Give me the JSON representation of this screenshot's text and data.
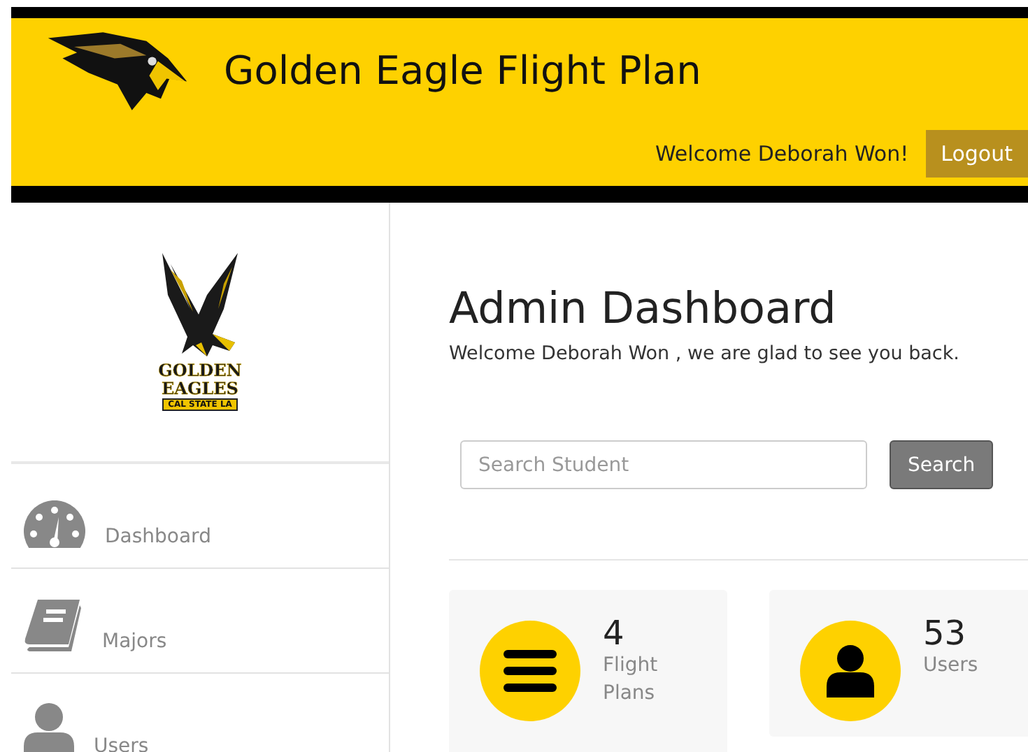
{
  "header": {
    "title": "Golden Eagle Flight Plan",
    "welcome": "Welcome Deborah Won!",
    "logout": "Logout"
  },
  "sidebar": {
    "logo": {
      "line_1": "GOLDEN",
      "line_2": "EAGLES",
      "banner": "CAL STATE LA"
    },
    "items": [
      {
        "label": "Dashboard",
        "kind": "gauge"
      },
      {
        "label": "Majors",
        "kind": "book"
      },
      {
        "label": "Users",
        "kind": "user"
      }
    ]
  },
  "main": {
    "title": "Admin Dashboard",
    "subtitle": "Welcome Deborah Won , we are glad to see you back.",
    "search": {
      "placeholder": "Search Student",
      "button": "Search"
    },
    "stats": [
      {
        "value": "4",
        "label": "Flight Plans",
        "kind": "list"
      },
      {
        "value": "53",
        "label": "Users",
        "kind": "user"
      }
    ]
  }
}
